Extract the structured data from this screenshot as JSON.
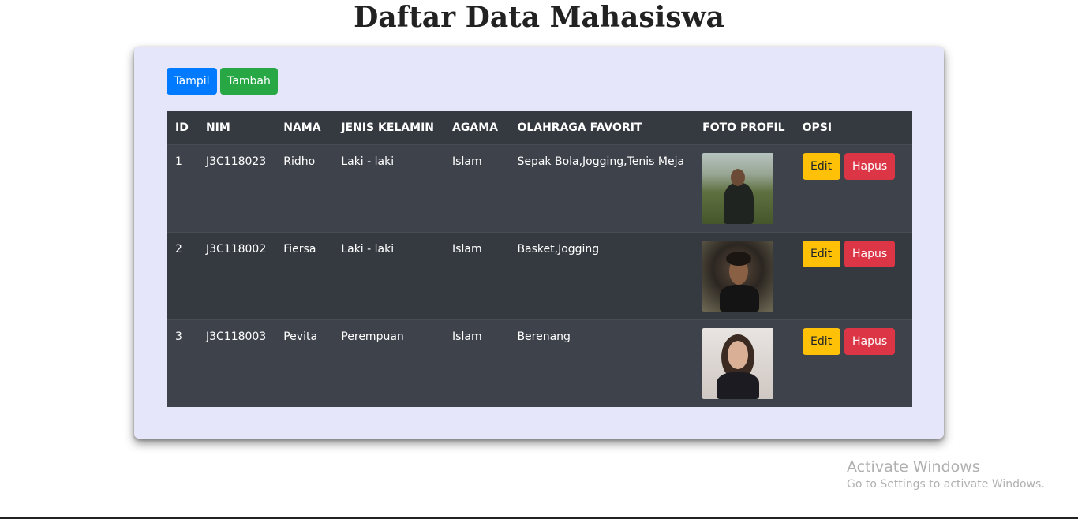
{
  "page": {
    "title": "Daftar Data Mahasiswa"
  },
  "toolbar": {
    "tampil_label": "Tampil",
    "tambah_label": "Tambah"
  },
  "table": {
    "headers": [
      "ID",
      "NIM",
      "NAMA",
      "JENIS KELAMIN",
      "AGAMA",
      "OLAHRAGA FAVORIT",
      "FOTO PROFIL",
      "OPSI"
    ],
    "rows": [
      {
        "id": "1",
        "nim": "J3C118023",
        "nama": "Ridho",
        "jenis_kelamin": "Laki - laki",
        "agama": "Islam",
        "olahraga": "Sepak Bola,Jogging,Tenis Meja",
        "edit_label": "Edit",
        "hapus_label": "Hapus"
      },
      {
        "id": "2",
        "nim": "J3C118002",
        "nama": "Fiersa",
        "jenis_kelamin": "Laki - laki",
        "agama": "Islam",
        "olahraga": "Basket,Jogging",
        "edit_label": "Edit",
        "hapus_label": "Hapus"
      },
      {
        "id": "3",
        "nim": "J3C118003",
        "nama": "Pevita",
        "jenis_kelamin": "Perempuan",
        "agama": "Islam",
        "olahraga": "Berenang",
        "edit_label": "Edit",
        "hapus_label": "Hapus"
      }
    ]
  },
  "watermark": {
    "title": "Activate Windows",
    "subtitle": "Go to Settings to activate Windows."
  },
  "colors": {
    "card_bg": "#e6e6fa",
    "table_header": "#343a40",
    "tampil": "#007bff",
    "tambah": "#28a745",
    "edit": "#ffc107",
    "hapus": "#dc3545"
  }
}
